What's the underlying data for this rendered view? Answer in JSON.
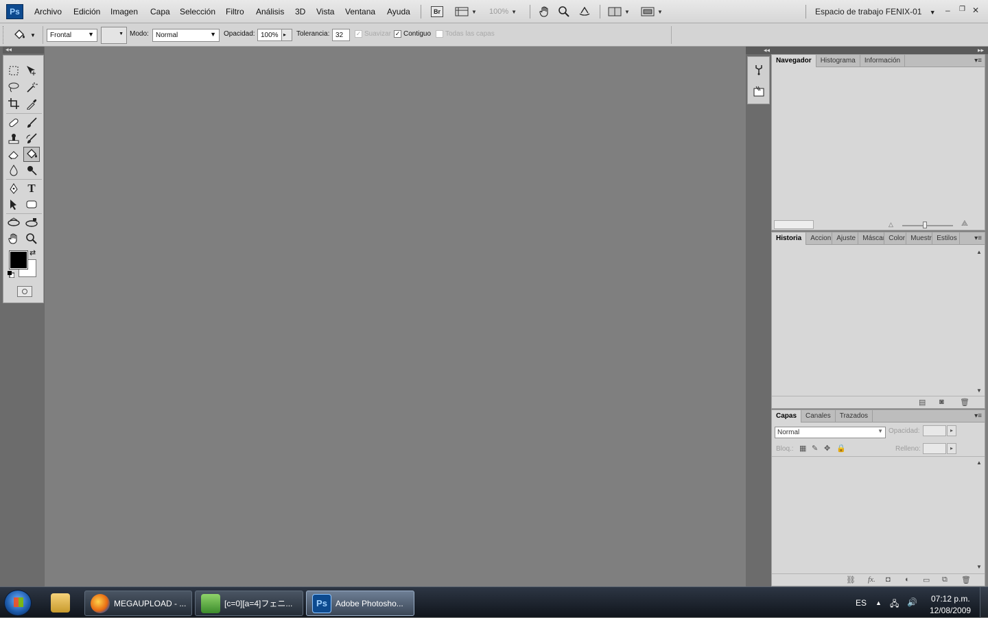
{
  "app": {
    "logo": "Ps",
    "menu": [
      "Archivo",
      "Edición",
      "Imagen",
      "Capa",
      "Selección",
      "Filtro",
      "Análisis",
      "3D",
      "Vista",
      "Ventana",
      "Ayuda"
    ],
    "bridge_label": "Br",
    "zoom_value": "100%",
    "workspace_label": "Espacio de trabajo FENIX-01"
  },
  "options": {
    "fill_source": "Frontal",
    "mode_label": "Modo:",
    "mode_value": "Normal",
    "opacity_label": "Opacidad:",
    "opacity_value": "100%",
    "tolerance_label": "Tolerancia:",
    "tolerance_value": "32",
    "antialias_label": "Suavizar",
    "antialias_checked": true,
    "contiguous_label": "Contiguo",
    "contiguous_checked": true,
    "all_layers_label": "Todas las capas",
    "all_layers_checked": false
  },
  "toolbox": {
    "active_tool": "paint-bucket",
    "foreground_color": "#000000",
    "background_color": "#ffffff"
  },
  "panels": {
    "navigator": {
      "tabs": [
        "Navegador",
        "Histograma",
        "Información"
      ]
    },
    "history": {
      "tabs": [
        "Historia",
        "Accion",
        "Ajuste",
        "Máscar",
        "Color",
        "Muestr",
        "Estilos"
      ]
    },
    "layers": {
      "tabs": [
        "Capas",
        "Canales",
        "Trazados"
      ],
      "blend_mode": "Normal",
      "opacity_label": "Opacidad:",
      "lock_label": "Bloq.:",
      "fill_label": "Relleno:"
    }
  },
  "taskbar": {
    "buttons": [
      "MEGAUPLOAD - ...",
      "[c=0][a=4]フェニ...",
      "Adobe Photosho..."
    ],
    "language": "ES",
    "time": "07:12 p.m.",
    "date": "12/08/2009"
  }
}
